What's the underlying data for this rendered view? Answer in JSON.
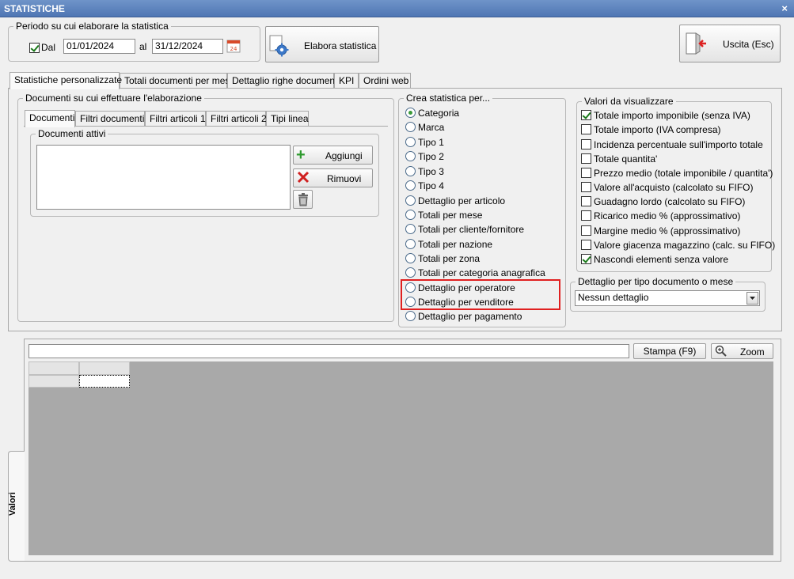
{
  "window": {
    "title": "STATISTICHE",
    "close_glyph": "×"
  },
  "periodo": {
    "label": "Periodo su cui elaborare la statistica",
    "dal_label": "Dal",
    "dal_checked": true,
    "dal_value": "01/01/2024",
    "al_label": "al",
    "al_value": "31/12/2024",
    "calendar_icon": "calendar-icon",
    "calendar_day": "24"
  },
  "buttons": {
    "elabora": "Elabora statistica",
    "uscita": "Uscita (Esc)"
  },
  "main_tabs": [
    "Statistiche personalizzate",
    "Totali documenti per mese",
    "Dettaglio righe documenti",
    "KPI",
    "Ordini web"
  ],
  "documenti_group": {
    "label": "Documenti su cui effettuare l'elaborazione",
    "tabs": [
      "Documenti",
      "Filtri documenti",
      "Filtri articoli 1",
      "Filtri articoli 2",
      "Tipi linea"
    ],
    "attivi_label": "Documenti attivi",
    "aggiungi": "Aggiungi",
    "rimuovi": "Rimuovi"
  },
  "crea": {
    "label": "Crea statistica per...",
    "options": [
      "Categoria",
      "Marca",
      "Tipo 1",
      "Tipo 2",
      "Tipo 3",
      "Tipo 4",
      "Dettaglio per articolo",
      "Totali per mese",
      "Totali per cliente/fornitore",
      "Totali per nazione",
      "Totali per zona",
      "Totali per categoria anagrafica",
      "Dettaglio per operatore",
      "Dettaglio per venditore",
      "Dettaglio per pagamento"
    ],
    "selected": "Categoria",
    "highlight_color": "#e02020"
  },
  "valori": {
    "label": "Valori da visualizzare",
    "options": [
      {
        "label": "Totale importo imponibile (senza IVA)",
        "checked": true
      },
      {
        "label": "Totale importo (IVA compresa)",
        "checked": false
      },
      {
        "label": "Incidenza percentuale sull'importo totale",
        "checked": false
      },
      {
        "label": "Totale quantita'",
        "checked": false
      },
      {
        "label": "Prezzo medio (totale imponibile / quantita')",
        "checked": false
      },
      {
        "label": "Valore all'acquisto (calcolato su FIFO)",
        "checked": false
      },
      {
        "label": "Guadagno lordo (calcolato su FIFO)",
        "checked": false
      },
      {
        "label": "Ricarico medio % (approssimativo)",
        "checked": false
      },
      {
        "label": "Margine medio % (approssimativo)",
        "checked": false
      },
      {
        "label": "Valore giacenza magazzino (calc. su FIFO)",
        "checked": false
      },
      {
        "label": "Nascondi elementi senza valore",
        "checked": true
      }
    ]
  },
  "dettaglio_tipo": {
    "label": "Dettaglio per tipo documento o mese",
    "selected": "Nessun dettaglio"
  },
  "results": {
    "side_tab": "Valori",
    "stampa": "Stampa (F9)",
    "zoom": "Zoom",
    "search_value": ""
  },
  "colors": {
    "titlebar": "#5a80bc",
    "grid_bg": "#a9a9a9",
    "accent_green": "#2e9a2e",
    "accent_red": "#d02020"
  }
}
